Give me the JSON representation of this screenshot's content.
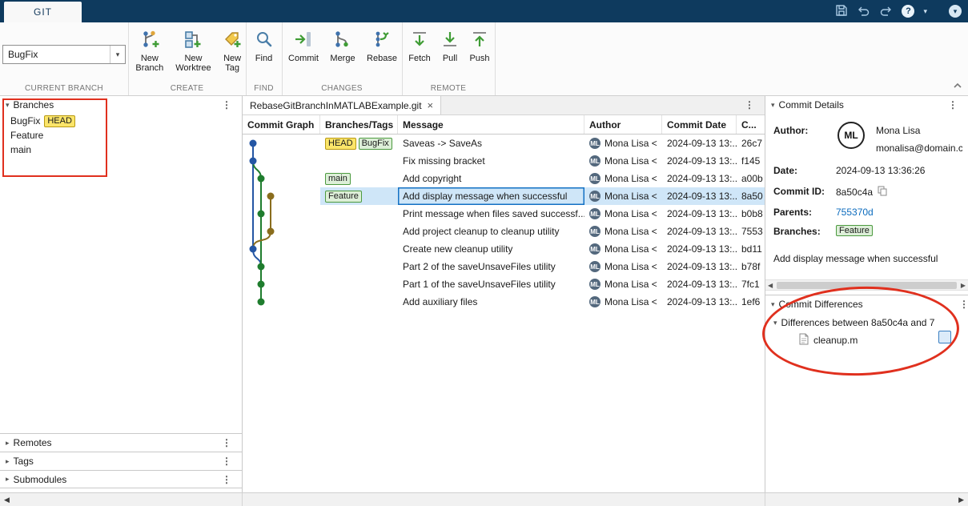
{
  "titlebar": {
    "tab": "GIT"
  },
  "ribbon": {
    "current_branch": {
      "value": "BugFix",
      "label": "CURRENT BRANCH"
    },
    "create": {
      "label": "CREATE",
      "buttons": [
        {
          "label": "New Branch"
        },
        {
          "label": "New Worktree"
        },
        {
          "label": "New Tag"
        }
      ]
    },
    "find": {
      "label": "FIND",
      "buttons": [
        {
          "label": "Find"
        }
      ]
    },
    "changes": {
      "label": "CHANGES",
      "buttons": [
        {
          "label": "Commit"
        },
        {
          "label": "Merge"
        },
        {
          "label": "Rebase"
        }
      ]
    },
    "remote": {
      "label": "REMOTE",
      "buttons": [
        {
          "label": "Fetch"
        },
        {
          "label": "Pull"
        },
        {
          "label": "Push"
        }
      ]
    }
  },
  "left_panel": {
    "branches": {
      "title": "Branches",
      "items": [
        {
          "name": "BugFix",
          "badge": "HEAD"
        },
        {
          "name": "Feature"
        },
        {
          "name": "main"
        }
      ]
    },
    "remotes": "Remotes",
    "tags": "Tags",
    "submodules": "Submodules"
  },
  "center": {
    "tab": "RebaseGitBranchInMATLABExample.git",
    "avatar_initials": "ML",
    "columns": [
      "Commit Graph",
      "Branches/Tags",
      "Message",
      "Author",
      "Commit Date",
      "C..."
    ],
    "rows": [
      {
        "badges": [
          {
            "label": "HEAD",
            "type": "head"
          },
          {
            "label": "BugFix",
            "type": "branch"
          }
        ],
        "message": "Saveas -> SaveAs",
        "author": "Mona Lisa <",
        "date": "2024-09-13 13:...",
        "id": "26c7"
      },
      {
        "badges": [],
        "message": "Fix missing bracket",
        "author": "Mona Lisa <",
        "date": "2024-09-13 13:...",
        "id": "f145"
      },
      {
        "badges": [
          {
            "label": "main",
            "type": "branch"
          }
        ],
        "message": "Add copyright",
        "author": "Mona Lisa <",
        "date": "2024-09-13 13:...",
        "id": "a00b"
      },
      {
        "badges": [
          {
            "label": "Feature",
            "type": "branch"
          }
        ],
        "selected": true,
        "message": "Add display message when successful",
        "author": "Mona Lisa <",
        "date": "2024-09-13 13:...",
        "id": "8a50"
      },
      {
        "badges": [],
        "message": "Print message when files saved successf...",
        "author": "Mona Lisa <",
        "date": "2024-09-13 13:...",
        "id": "b0b8"
      },
      {
        "badges": [],
        "message": "Add project cleanup to cleanup utility",
        "author": "Mona Lisa <",
        "date": "2024-09-13 13:...",
        "id": "7553"
      },
      {
        "badges": [],
        "message": "Create new cleanup utility",
        "author": "Mona Lisa <",
        "date": "2024-09-13 13:...",
        "id": "bd11"
      },
      {
        "badges": [],
        "message": "Part 2 of the saveUnsaveFiles utility",
        "author": "Mona Lisa <",
        "date": "2024-09-13 13:...",
        "id": "b78f"
      },
      {
        "badges": [],
        "message": "Part 1 of the saveUnsaveFiles utility",
        "author": "Mona Lisa <",
        "date": "2024-09-13 13:...",
        "id": "7fc1"
      },
      {
        "badges": [],
        "message": "Add auxiliary files",
        "author": "Mona Lisa <",
        "date": "2024-09-13 13:...",
        "id": "1ef6"
      }
    ]
  },
  "details": {
    "title": "Commit Details",
    "author_label": "Author:",
    "author_initials": "ML",
    "author_name": "Mona Lisa",
    "author_email": "monalisa@domain.co",
    "date_label": "Date:",
    "date": "2024-09-13 13:36:26",
    "commit_id_label": "Commit ID:",
    "commit_id": "8a50c4a",
    "parents_label": "Parents:",
    "parents": "755370d",
    "branches_label": "Branches:",
    "branch": "Feature",
    "message": "Add display message when successful"
  },
  "differences": {
    "title": "Commit Differences",
    "group": "Differences between 8a50c4a and 7",
    "file": "cleanup.m"
  },
  "colors": {
    "titlebar": "#0e3a5e",
    "selection": "#cfe6f8",
    "selection_border": "#1371c4",
    "annotation": "#e0301e",
    "link": "#0b6bbd",
    "badge_head_bg": "#fbe56a",
    "badge_branch_bg": "#ddefd8",
    "graph_blue": "#2456a4",
    "graph_green": "#1f7d2e",
    "graph_olive": "#8a6d1d"
  }
}
